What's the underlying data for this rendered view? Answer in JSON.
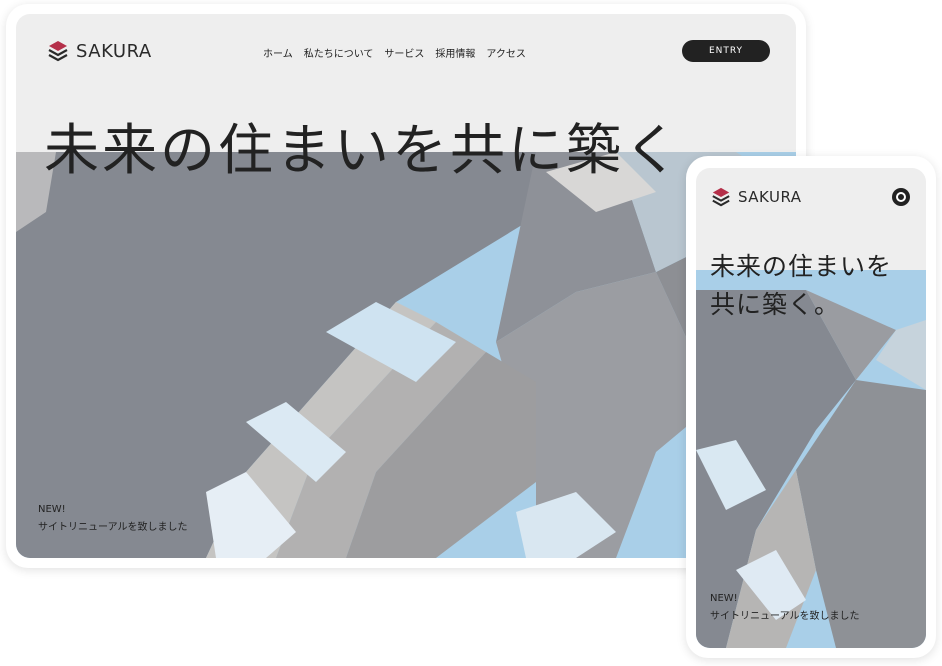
{
  "desktop": {
    "logo_text": "SAKURA",
    "nav": [
      "ホーム",
      "私たちについて",
      "サービス",
      "採用情報",
      "アクセス"
    ],
    "entry_label": "ENTRY",
    "headline": "未来の住まいを共に築く",
    "news_badge": "NEW!",
    "news_text": "サイトリニューアルを致しました"
  },
  "mobile": {
    "logo_text": "SAKURA",
    "headline_line1": "未来の住まいを",
    "headline_line2": "共に築く。",
    "news_badge": "NEW!",
    "news_text": "サイトリニューアルを致しました"
  },
  "colors": {
    "screen_bg": "#eeeeee",
    "logo_accent": "#b5304a",
    "text": "#222222",
    "sky": "#a9cfe8"
  }
}
